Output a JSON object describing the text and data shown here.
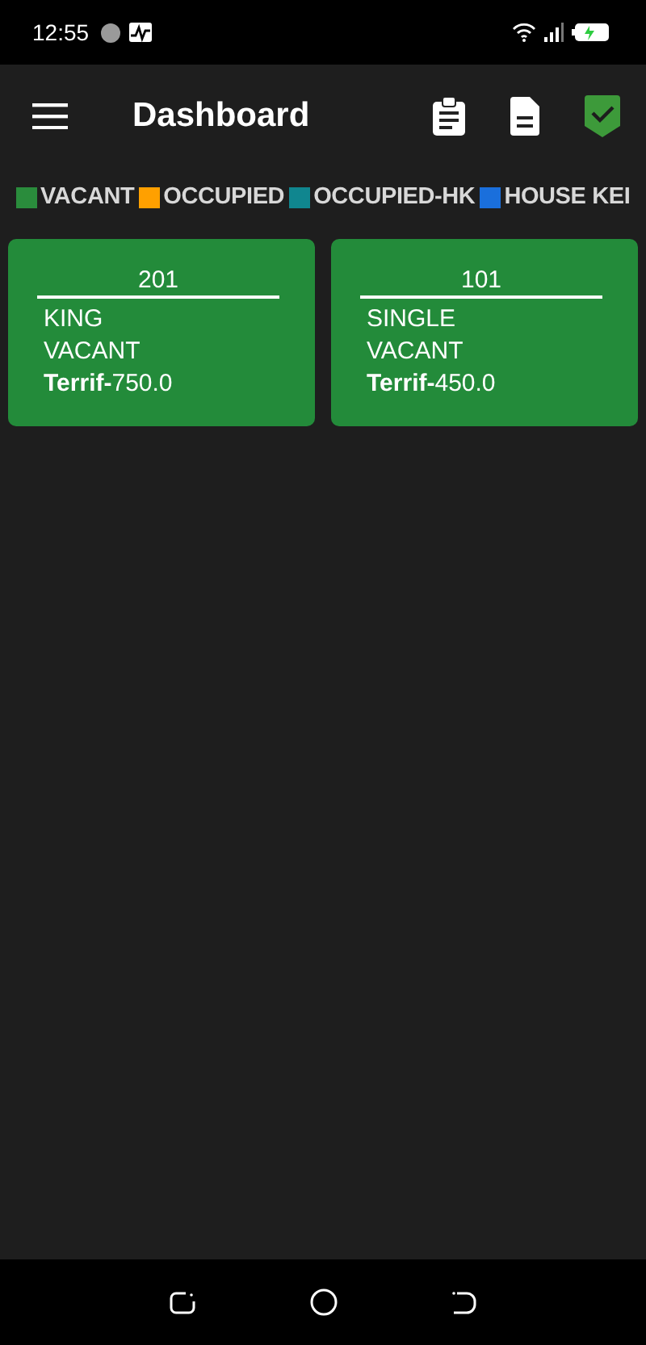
{
  "status_bar": {
    "time": "12:55"
  },
  "app_bar": {
    "title": "Dashboard"
  },
  "legend": [
    {
      "label": "VACANT",
      "color": "#2a8c3c"
    },
    {
      "label": "OCCUPIED",
      "color": "#ffa000"
    },
    {
      "label": "OCCUPIED-HK",
      "color": "#10868f"
    },
    {
      "label": "HOUSE KEI",
      "color": "#1a6fdc"
    }
  ],
  "rooms": [
    {
      "number": "201",
      "type": "KING",
      "status": "VACANT",
      "tariff_label": "Terrif-",
      "tariff": "750.0",
      "color": "#238b3a"
    },
    {
      "number": "101",
      "type": "SINGLE",
      "status": "VACANT",
      "tariff_label": "Terrif-",
      "tariff": "450.0",
      "color": "#238b3a"
    }
  ]
}
